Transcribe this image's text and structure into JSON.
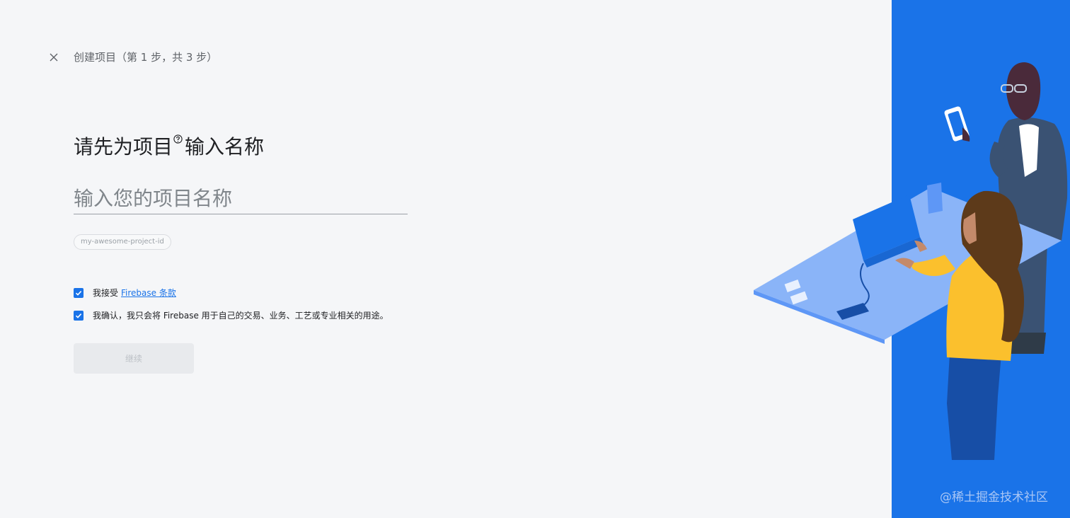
{
  "header": {
    "close_icon": "close-icon",
    "step_title": "创建项目（第 1 步，共 3 步）"
  },
  "main": {
    "heading_before": "请先为项目",
    "help_icon": "help-circle-icon",
    "heading_after": "输入名称",
    "name_input": {
      "placeholder": "输入您的项目名称",
      "value": ""
    },
    "project_id": "my-awesome-project-id",
    "terms": {
      "checked": true,
      "prefix": "我接受",
      "link": "Firebase 条款"
    },
    "usage": {
      "checked": true,
      "label": "我确认，我只会将 Firebase 用于自己的交易、业务、工艺或专业相关的用途。"
    },
    "continue_label": "继续"
  },
  "side": {
    "accent_color": "#1a73e8",
    "watermark": "@稀土掘金技术社区"
  }
}
